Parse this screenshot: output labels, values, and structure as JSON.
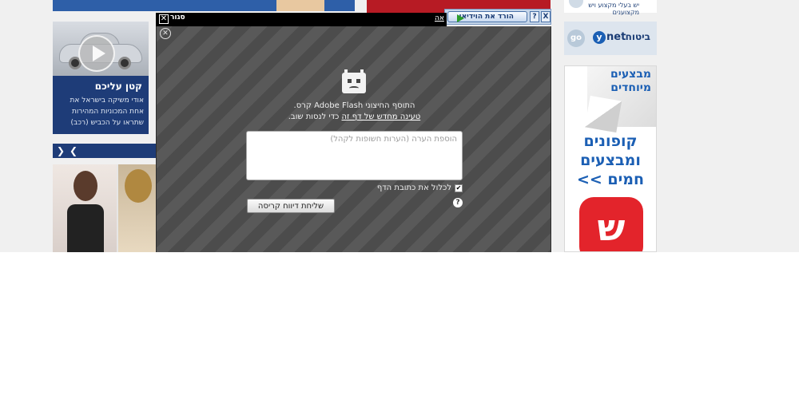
{
  "page_bg": "#f0f0f0",
  "left_column": {
    "car_article": {
      "title": "קטן עליכם",
      "text": "אודי משיקה בישראל את אחת המכוניות המהירות שתראו על הכביש (רכב)"
    },
    "nav_arrows": {
      "prev": "❮",
      "next": "❯"
    }
  },
  "right_column": {
    "top_strip_text": "יש בעלי מקצוע ויש מקצוענים",
    "go_label": "go",
    "ynet_logo": {
      "y": "y",
      "rest": "net"
    },
    "insurance_label": "ביטוח",
    "promo": {
      "special_label": "מבצעים מיוחדים",
      "main_label": "קופונים ומבצעים חמים >>",
      "shop_icon": "ש"
    }
  },
  "video_bar": {
    "download_label": "הורד את הוידיאו",
    "help": "?",
    "close": "X"
  },
  "popup_header": {
    "close_box": "✕",
    "close_label": "סגור",
    "trail_text": "אה"
  },
  "crash_panel": {
    "close_glyph": "✕",
    "message_line1": "התוסף החיצוני Adobe Flash קרס.",
    "message_line2_link": "טעינה מחדש של דף זה",
    "message_line2_rest": " כדי לנסות שוב.",
    "comment_placeholder": "הוספת הערה (הערות חשופות לקהל)",
    "include_label": "לכלול את כתובת הדף",
    "include_checked_glyph": "✔",
    "help_glyph": "?",
    "send_button": "שליחת דיווח קריסה"
  },
  "colors": {
    "header_black": "#000000",
    "stripe_dark": "#4c4c4c",
    "stripe_light": "#595959",
    "ynet_blue": "#1b3d75",
    "promo_blue": "#1b5fb4",
    "shop_red": "#e3242b"
  }
}
